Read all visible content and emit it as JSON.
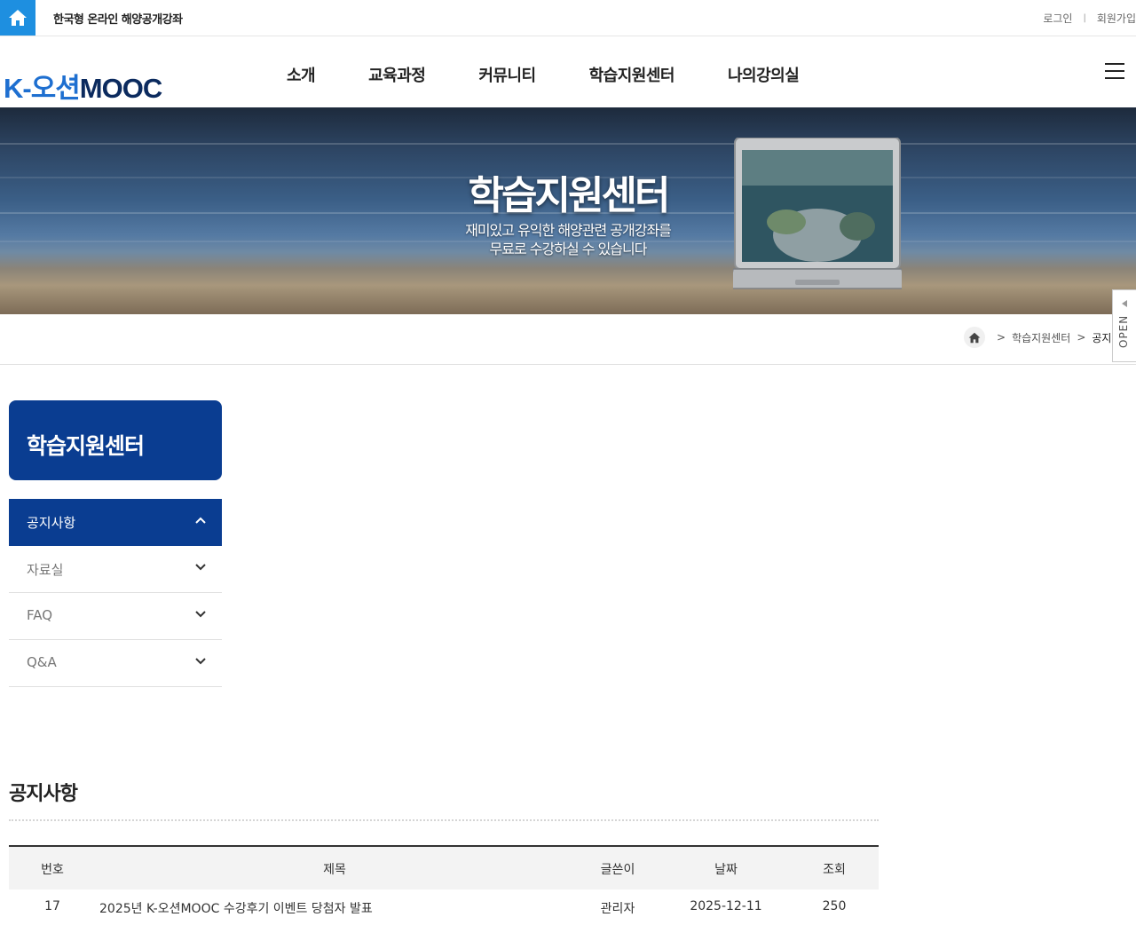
{
  "topbar": {
    "site_name": "한국형 온라인 해양공개강좌",
    "login": "로그인",
    "separator": "|",
    "signup": "회원가입"
  },
  "header": {
    "logo_prefix": "K-오션",
    "logo_suffix": "MOOC",
    "nav": [
      "소개",
      "교육과정",
      "커뮤니티",
      "학습지원센터",
      "나의강의실"
    ]
  },
  "banner": {
    "title": "학습지원센터",
    "subtitle_line1": "재미있고 유익한 해양관련 공개강좌를",
    "subtitle_line2": "무료로 수강하실 수 있습니다"
  },
  "breadcrumb": {
    "sep": ">",
    "level1": "학습지원센터",
    "level2": "공지사항"
  },
  "open_tab": "OPEN",
  "sidebar": {
    "title": "학습지원센터",
    "items": [
      {
        "label": "공지사항",
        "active": true
      },
      {
        "label": "자료실",
        "active": false
      },
      {
        "label": "FAQ",
        "active": false
      },
      {
        "label": "Q&A",
        "active": false
      }
    ]
  },
  "content": {
    "title": "공지사항",
    "columns": {
      "no": "번호",
      "title": "제목",
      "author": "글쓴이",
      "date": "날짜",
      "views": "조회"
    },
    "rows": [
      {
        "no": "17",
        "title": "2025년 K-오션MOOC 수강후기 이벤트 당첨자 발표",
        "author": "관리자",
        "date": "2025-12-11",
        "views": "250"
      }
    ]
  },
  "colors": {
    "primary": "#0a3d91",
    "accent": "#1e8fe0",
    "logo_blue": "#1e6fd0"
  }
}
